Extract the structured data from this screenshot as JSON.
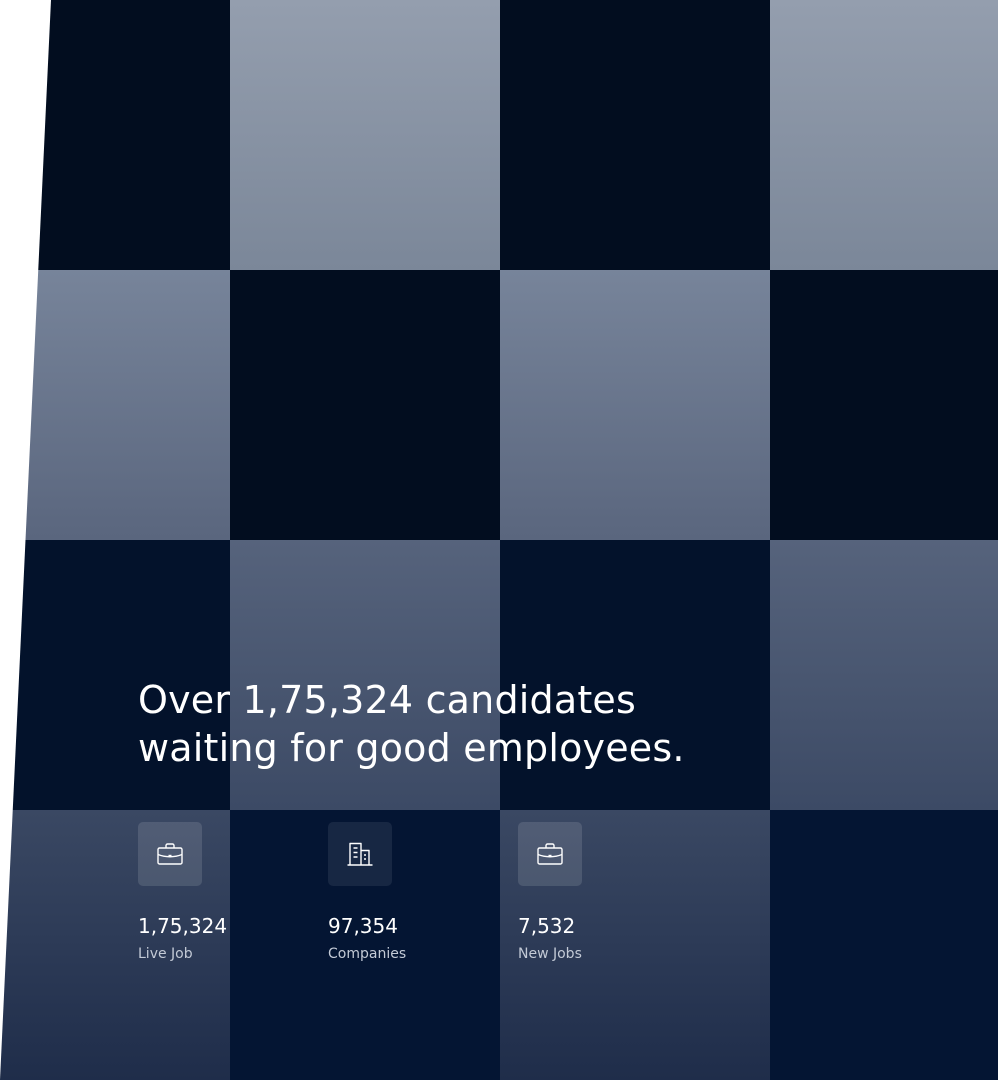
{
  "hero": {
    "headline_line1": "Over 1,75,324 candidates",
    "headline_line2": "waiting for good employees."
  },
  "stats": [
    {
      "icon": "briefcase-icon",
      "number": "1,75,324",
      "label": "Live Job"
    },
    {
      "icon": "building-icon",
      "number": "97,354",
      "label": "Companies"
    },
    {
      "icon": "briefcase-icon",
      "number": "7,532",
      "label": "New Jobs"
    }
  ],
  "colors": {
    "dark_tile": "#020d1f",
    "light_tile_top": "#949eae",
    "light_tile_bottom": "#1f2d4a",
    "text": "#ffffff",
    "muted_text": "#c3cad6"
  }
}
